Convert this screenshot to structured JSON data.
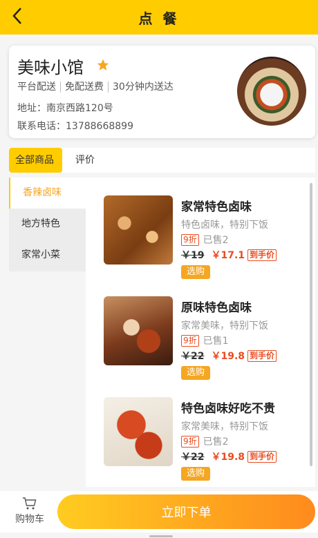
{
  "header": {
    "title": "点 餐"
  },
  "shop": {
    "name": "美味小馆",
    "tags": [
      "平台配送",
      "免配送费",
      "30分钟内送达"
    ],
    "address": "地址：南京西路120号",
    "phone": "联系电话：13788668899"
  },
  "tabs": [
    {
      "label": "全部商品",
      "active": true
    },
    {
      "label": "评价",
      "active": false
    }
  ],
  "categories": [
    {
      "label": "香辣卤味",
      "active": true
    },
    {
      "label": "地方特色",
      "active": false
    },
    {
      "label": "家常小菜",
      "active": false
    }
  ],
  "products": [
    {
      "title": "家常特色卤味",
      "desc": "特色卤味，特别下饭",
      "discount": "9折",
      "sold": "已售2",
      "old_price": "￥19",
      "new_price": "￥17.1",
      "price_tag": "到手价",
      "button": "选购"
    },
    {
      "title": "原味特色卤味",
      "desc": "家常美味，特别下饭",
      "discount": "9折",
      "sold": "已售1",
      "old_price": "￥22",
      "new_price": "￥19.8",
      "price_tag": "到手价",
      "button": "选购"
    },
    {
      "title": "特色卤味好吃不贵",
      "desc": "家常美味，特别下饭",
      "discount": "9折",
      "sold": "已售2",
      "old_price": "￥22",
      "new_price": "￥19.8",
      "price_tag": "到手价",
      "button": "选购"
    }
  ],
  "bottom": {
    "cart_label": "购物车",
    "order_button": "立即下单"
  },
  "colors": {
    "accent": "#FFCC00",
    "price": "#E94B1F",
    "button": "#F5A623"
  }
}
